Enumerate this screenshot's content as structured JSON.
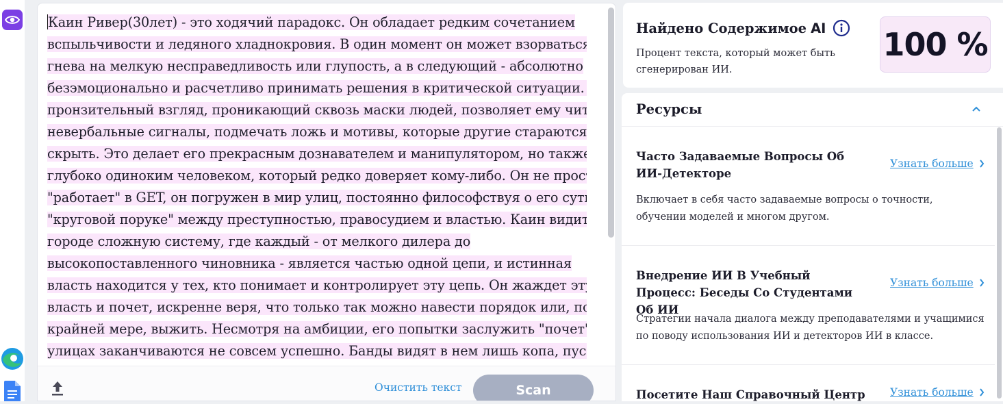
{
  "editor": {
    "text_lines": [
      "Каин Ривер(30лет) - это ходячий парадокс. Он обладает редким сочетанием",
      "вспыльчивости и ледяного хладнокровия. В один момент он может взорваться от",
      "гнева на мелкую несправедливость или глупость, а в следующий - абсолютно",
      "безэмоционально и расчетливо принимать решения в критической ситуации. Его",
      "пронзительный взгляд, проникающий сквозь маски людей, позволяет ему читать",
      "невербальные сигналы, подмечать ложь и мотивы, которые другие стараются",
      "скрыть. Это делает его прекрасным дознавателем и манипулятором, но также и",
      "глубоко одиноким человеком, который редко доверяет кому-либо. Он не просто",
      "\"работает\" в GET, он погружен в мир улиц, постоянно философствуя о его сути, о",
      "\"круговой поруке\" между преступностью, правосудием и властью. Каин видит в",
      "городе сложную систему, где каждый - от мелкого дилера до",
      "высокопоставленного чиновника - является частью одной цепи, и истинная",
      "власть находится у тех, кто понимает и контролирует эту цепь. Он жаждет эту",
      "власть и почет, искренне веря, что только так можно навести порядок или, по",
      "крайней мере, выжить. Несмотря на амбиции, его попытки заслужить \"почет\" на",
      "улицах заканчиваются не совсем успешно. Банды видят в нем лишь копа, пусть и"
    ],
    "clear_label": "Очистить текст",
    "scan_label": "Scan"
  },
  "result": {
    "title": "Найдено Содержимое",
    "title_ai": "AI",
    "description": "Процент текста, который может быть сгенерирован ИИ.",
    "percent": "100 %"
  },
  "resources": {
    "title": "Ресурсы",
    "items": [
      {
        "title": "Часто Задаваемые Вопросы Об ИИ-Детекторе",
        "link": "Узнать больше",
        "description": "Включает в себя часто задаваемые вопросы о точности, обучении моделей и многом другом."
      },
      {
        "title": "Внедрение ИИ В Учебный Процесс: Беседы Со Студентами Об ИИ",
        "link": "Узнать больше",
        "description": "Стратегии начала диалога между преподавателями и учащимися по поводу использования ИИ и детекторов ИИ в классе."
      },
      {
        "title": "Посетите Наш Справочный Центр",
        "link": "Узнать больше",
        "description": ""
      }
    ]
  },
  "colors": {
    "accent_purple": "#7b3fe4",
    "highlight_pink": "#fbe6fb",
    "link_blue": "#2f8fd8",
    "scan_disabled": "#a7afc2"
  },
  "icons": [
    "eye-icon",
    "edge-browser-icon",
    "google-docs-icon",
    "upload-icon",
    "info-icon",
    "chevron-up-icon",
    "chevron-right-icon"
  ]
}
